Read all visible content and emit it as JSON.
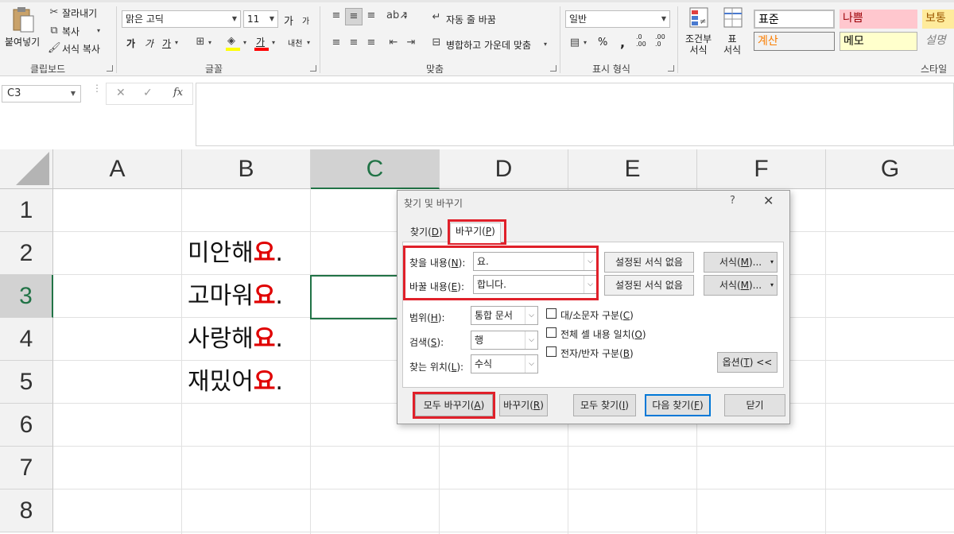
{
  "ribbon": {
    "clipboard": {
      "paste": "붙여넣기",
      "cut": "잘라내기",
      "copy": "복사",
      "format_painter": "서식 복사",
      "group": "클립보드"
    },
    "font": {
      "font_name": "맑은 고딕",
      "font_size": "11",
      "grow": "가",
      "shrink": "가",
      "bold": "가",
      "italic": "가",
      "underline": "가",
      "font_color_glyph": "가",
      "phonetic": "내천",
      "group": "글꼴"
    },
    "alignment": {
      "wrap_text": "자동 줄 바꿈",
      "merge_center": "병합하고 가운데 맞춤",
      "group": "맞춤"
    },
    "number": {
      "format": "일반",
      "percent": "%",
      "comma": ",",
      "inc_decimal": ".0\n.00",
      "dec_decimal": ".00\n.0",
      "group": "표시 형식"
    },
    "styles": {
      "conditional": "조건부\n서식",
      "table": "표\n서식",
      "cells": [
        {
          "label": "표준",
          "bg": "#ffffff",
          "color": "#000000"
        },
        {
          "label": "나쁨",
          "bg": "#ffc7ce",
          "color": "#9c0006"
        },
        {
          "label": "보통",
          "bg": "#ffeb9c",
          "color": "#9c5700"
        },
        {
          "label": "계산",
          "bg": "#f2f2f2",
          "color": "#fa7d00"
        },
        {
          "label": "메모",
          "bg": "#ffffcc",
          "color": "#000000"
        },
        {
          "label": "설명",
          "bg": "#f3f3f3",
          "color": "#7f7f7f"
        }
      ],
      "group": "스타일"
    }
  },
  "formula_bar": {
    "name_box": "C3",
    "cancel": "✕",
    "enter": "✓",
    "fx": "fx",
    "value": ""
  },
  "grid": {
    "columns": [
      "A",
      "B",
      "C",
      "D",
      "E",
      "F",
      "G"
    ],
    "rows": [
      "1",
      "2",
      "3",
      "4",
      "5",
      "6",
      "7",
      "8"
    ],
    "selected_column": "C",
    "selected_row": "3",
    "cells": [
      {
        "row": "2",
        "prefix": "미안해",
        "highlight": "요",
        "suffix": "."
      },
      {
        "row": "3",
        "prefix": "고마워",
        "highlight": "요",
        "suffix": "."
      },
      {
        "row": "4",
        "prefix": "사랑해",
        "highlight": "요",
        "suffix": "."
      },
      {
        "row": "5",
        "prefix": "재밌어",
        "highlight": "요",
        "suffix": "."
      }
    ]
  },
  "dialog": {
    "title": "찾기 및 바꾸기",
    "help": "?",
    "close": "✕",
    "tabs": {
      "find": {
        "text": "찾기(",
        "key": "D",
        "end": ")"
      },
      "replace": {
        "text": "바꾸기(",
        "key": "P",
        "end": ")"
      }
    },
    "find_what": {
      "label": "찾을 내용(",
      "key": "N",
      "end": "):",
      "value": "요."
    },
    "replace_with": {
      "label": "바꿀 내용(",
      "key": "E",
      "end": "):",
      "value": "합니다."
    },
    "no_format_1": "설정된 서식 없음",
    "no_format_2": "설정된 서식 없음",
    "format_1": {
      "text": "서식(",
      "key": "M",
      "end": ")..."
    },
    "format_2": {
      "text": "서식(",
      "key": "M",
      "end": ")..."
    },
    "within": {
      "label": "범위(",
      "key": "H",
      "end": "):",
      "value": "통합 문서"
    },
    "search": {
      "label": "검색(",
      "key": "S",
      "end": "):",
      "value": "행"
    },
    "look_in": {
      "label": "찾는 위치(",
      "key": "L",
      "end": "):",
      "value": "수식"
    },
    "match_case": {
      "text": "대/소문자 구분(",
      "key": "C",
      "end": ")",
      "checked": false
    },
    "match_entire": {
      "text": "전체 셀 내용 일치(",
      "key": "O",
      "end": ")",
      "checked": false
    },
    "match_byte": {
      "text": "전자/반자 구분(",
      "key": "B",
      "end": ")",
      "checked": false
    },
    "options": {
      "text": "옵션(",
      "key": "T",
      "end": ") <<"
    },
    "replace_all": {
      "text": "모두 바꾸기(",
      "key": "A",
      "end": ")"
    },
    "replace": {
      "text": "바꾸기(",
      "key": "R",
      "end": ")"
    },
    "find_all": {
      "text": "모두 찾기(",
      "key": "I",
      "end": ")"
    },
    "find_next": {
      "text": "다음 찾기(",
      "key": "F",
      "end": ")"
    },
    "close_button": "닫기"
  }
}
